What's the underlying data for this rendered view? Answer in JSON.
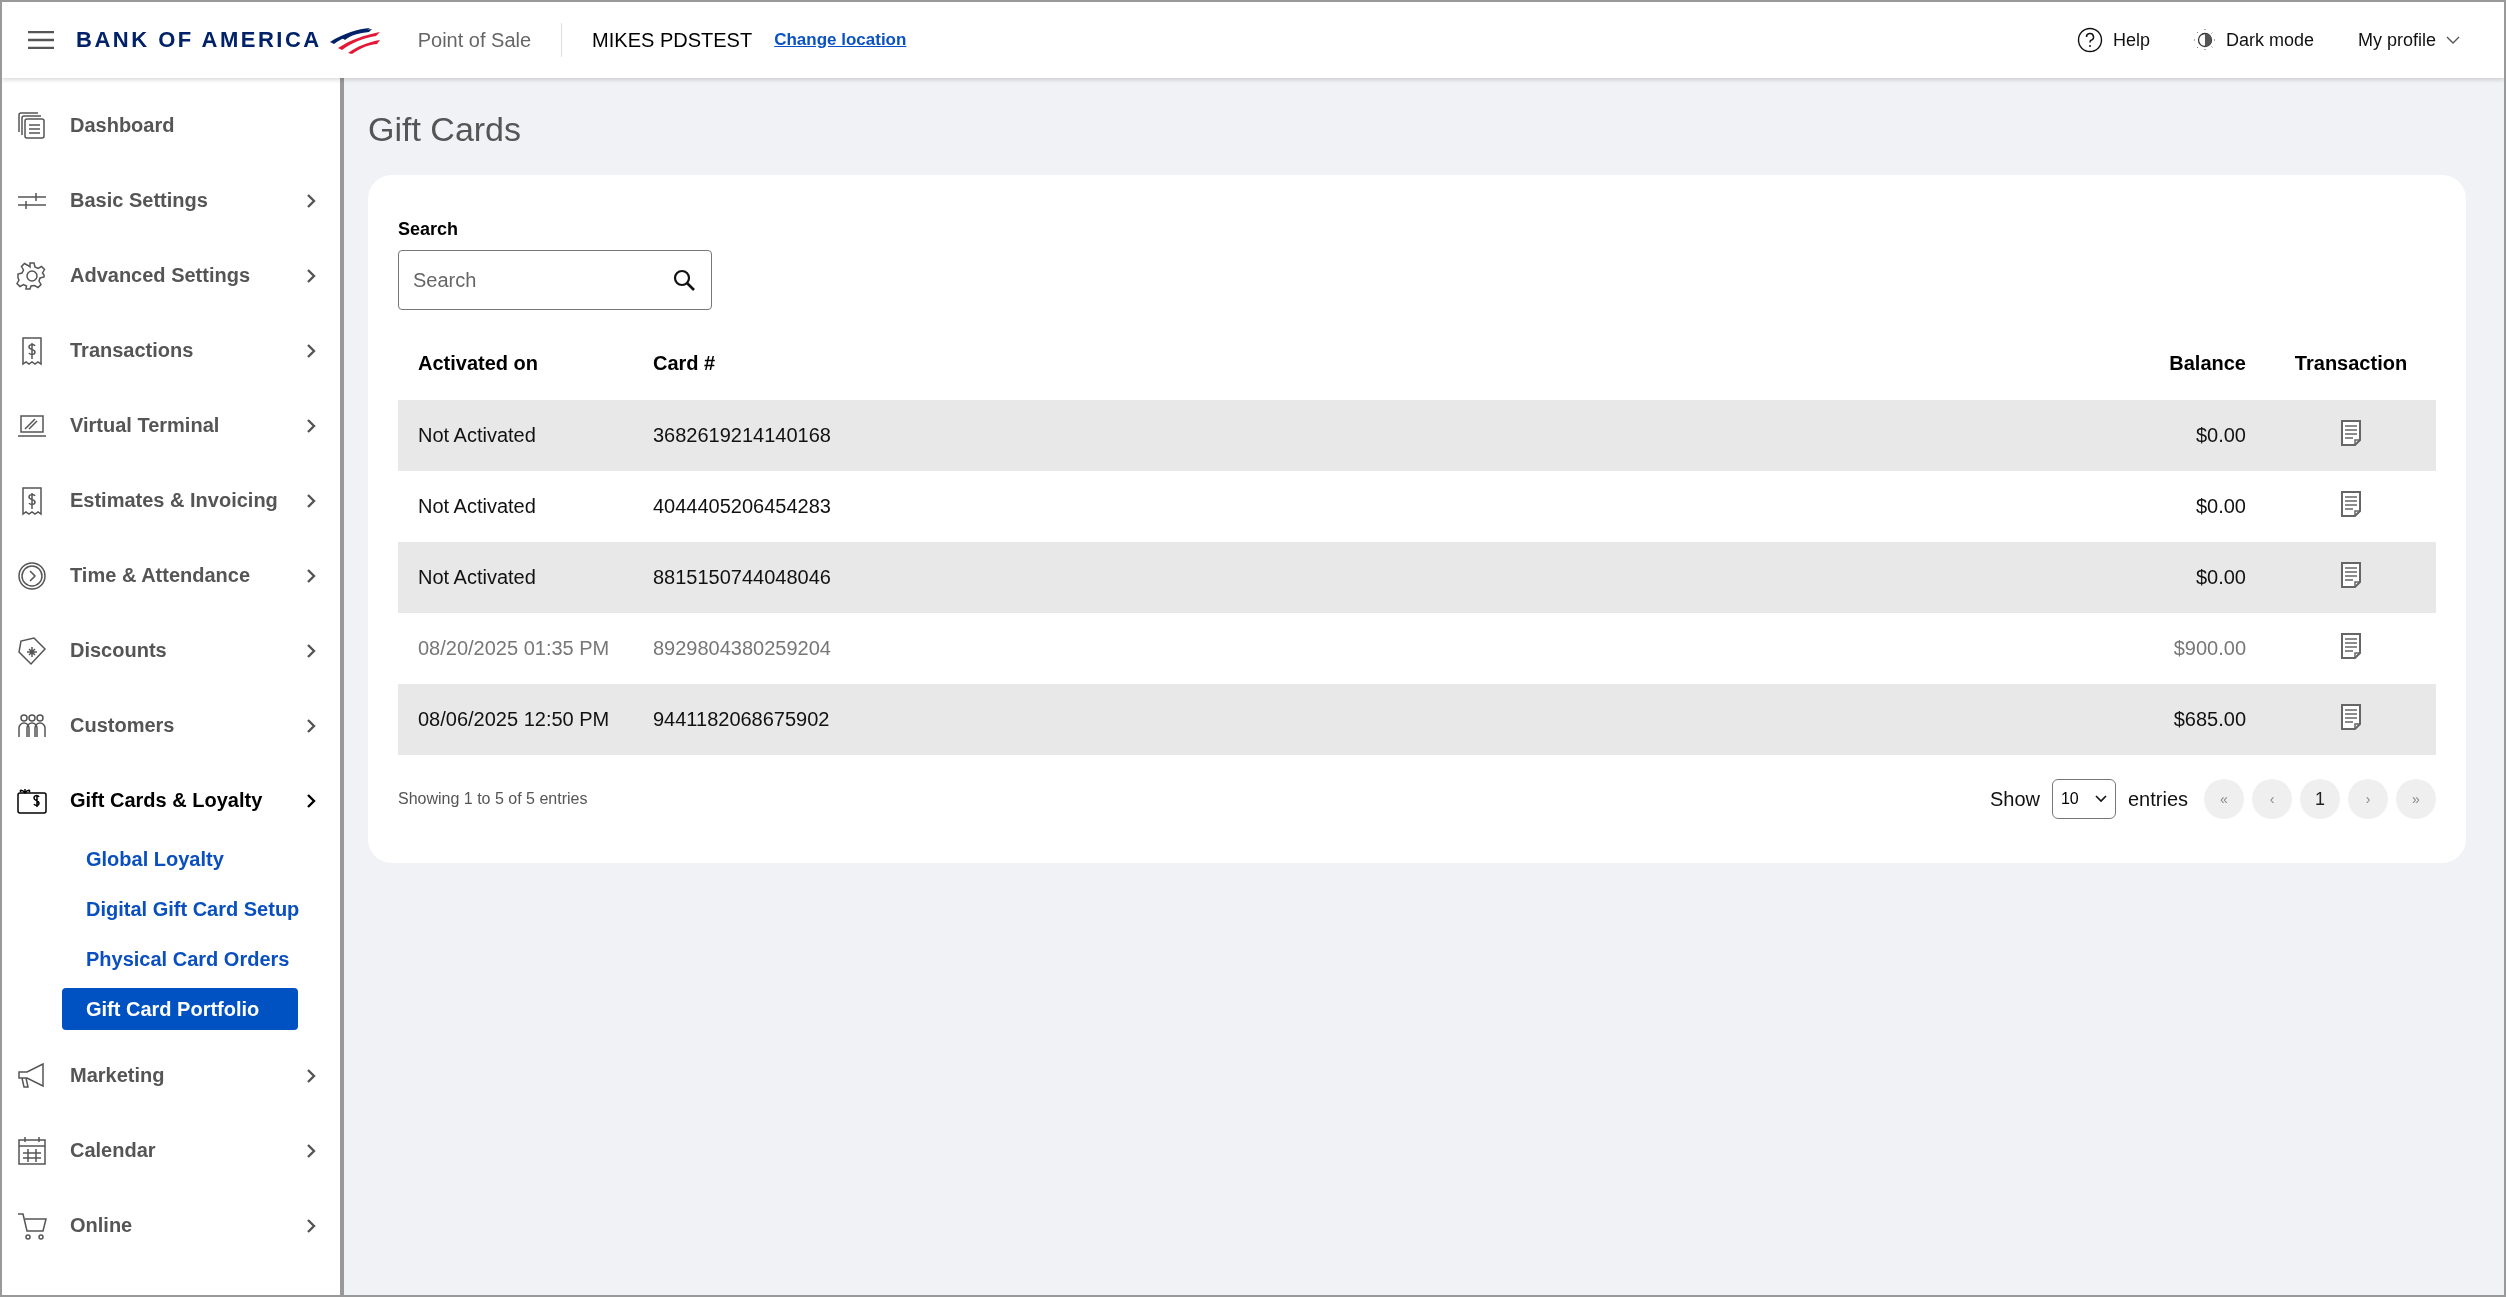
{
  "header": {
    "brand": "BANK OF AMERICA",
    "product": "Point of Sale",
    "location": "MIKES PDSTEST",
    "change_location": "Change location",
    "actions": [
      {
        "kind": "help",
        "label": "Help"
      },
      {
        "kind": "theme",
        "label": "Dark mode"
      },
      {
        "kind": "profile",
        "label": "My profile"
      }
    ]
  },
  "sidebar": {
    "items": [
      {
        "label": "Dashboard",
        "expanded": false,
        "has_chevron": false
      },
      {
        "label": "Basic Settings",
        "expanded": false,
        "has_chevron": true
      },
      {
        "label": "Advanced Settings",
        "expanded": false,
        "has_chevron": true
      },
      {
        "label": "Transactions",
        "expanded": false,
        "has_chevron": true
      },
      {
        "label": "Virtual Terminal",
        "expanded": false,
        "has_chevron": true
      },
      {
        "label": "Estimates & Invoicing",
        "expanded": false,
        "has_chevron": true
      },
      {
        "label": "Time & Attendance",
        "expanded": false,
        "has_chevron": true
      },
      {
        "label": "Discounts",
        "expanded": false,
        "has_chevron": true
      },
      {
        "label": "Customers",
        "expanded": false,
        "has_chevron": true
      },
      {
        "label": "Gift Cards & Loyalty",
        "expanded": true,
        "has_chevron": true,
        "children": [
          {
            "label": "Global Loyalty",
            "selected": false
          },
          {
            "label": "Digital Gift Card Setup",
            "selected": false
          },
          {
            "label": "Physical Card Orders",
            "selected": false
          },
          {
            "label": "Gift Card Portfolio",
            "selected": true
          }
        ]
      },
      {
        "label": "Marketing",
        "expanded": false,
        "has_chevron": true
      },
      {
        "label": "Calendar",
        "expanded": false,
        "has_chevron": true
      },
      {
        "label": "Online",
        "expanded": false,
        "has_chevron": true
      }
    ]
  },
  "page": {
    "title": "Gift Cards",
    "search": {
      "label": "Search",
      "placeholder": "Search"
    },
    "table": {
      "columns": [
        "Activated on",
        "Card #",
        "Balance",
        "Transaction"
      ],
      "rows": [
        {
          "activated_on": "Not Activated",
          "card": "3682619214140168",
          "balance": "$0.00",
          "disabled": false
        },
        {
          "activated_on": "Not Activated",
          "card": "4044405206454283",
          "balance": "$0.00",
          "disabled": false
        },
        {
          "activated_on": "Not Activated",
          "card": "8815150744048046",
          "balance": "$0.00",
          "disabled": false
        },
        {
          "activated_on": "08/20/2025 01:35 PM",
          "card": "8929804380259204",
          "balance": "$900.00",
          "disabled": true
        },
        {
          "activated_on": "08/06/2025 12:50 PM",
          "card": "9441182068675902",
          "balance": "$685.00",
          "disabled": false
        }
      ]
    },
    "footer": {
      "info": "Showing 1 to 5 of 5 entries",
      "show_label": "Show",
      "page_size": "10",
      "entries_label": "entries",
      "pager": [
        {
          "label": "«",
          "disabled": true
        },
        {
          "label": "‹",
          "disabled": true
        },
        {
          "label": "1",
          "disabled": false
        },
        {
          "label": "›",
          "disabled": true
        },
        {
          "label": "»",
          "disabled": true
        }
      ]
    }
  }
}
